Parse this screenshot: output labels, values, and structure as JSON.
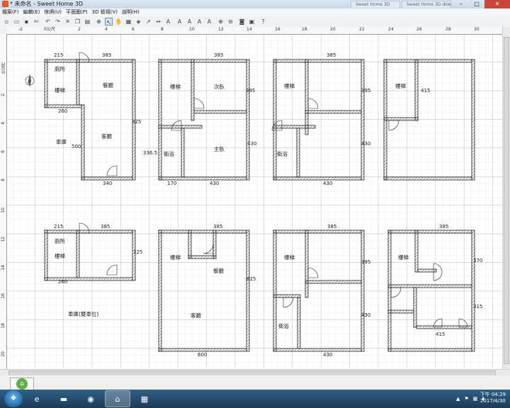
{
  "window": {
    "title": "* 未命名 - Sweet Home 3D",
    "ghost_tabs": [
      "Sweet Home 3D",
      "Sweet Home 3D download"
    ],
    "controls": [
      "–",
      "□",
      "✕"
    ]
  },
  "menu": [
    "檔案(F)",
    "編輯(E)",
    "傢俱(U)",
    "平面圖(P)",
    "3D 檢視(V)",
    "說明(H)"
  ],
  "toolbar_icons": [
    "new-icon",
    "open-icon",
    "save-icon",
    "cut-icon",
    "undo-icon",
    "redo-icon",
    "delete-icon",
    "copy-icon",
    "paste-icon",
    "add-furniture-icon",
    "select-icon",
    "pan-icon",
    "create-walls-icon",
    "create-rooms-icon",
    "create-dimensions-icon",
    "add-text-icon",
    "zoom-in-icon",
    "zoom-out-icon",
    "camera-icon",
    "photo-icon",
    "video-icon",
    "help-icon"
  ],
  "ruler": {
    "top": [
      "-2",
      "0公尺",
      "2",
      "4",
      "6",
      "8",
      "10",
      "12",
      "14",
      "16",
      "18",
      "20",
      "22",
      "24",
      "26",
      "28",
      "30"
    ],
    "left": [
      "0公尺",
      "2",
      "4",
      "6",
      "8",
      "10",
      "12",
      "14",
      "16",
      "18",
      "20"
    ]
  },
  "plans": [
    {
      "labels": [
        "廁所",
        "樓梯",
        "餐廳",
        "客廳",
        "車庫"
      ],
      "dims": [
        "215",
        "385",
        "260",
        "825",
        "500",
        "340"
      ]
    },
    {
      "labels": [
        "樓梯",
        "次臥",
        "衛浴",
        "主臥"
      ],
      "dims": [
        "385",
        "395",
        "336.5",
        "430",
        "170",
        "430"
      ]
    },
    {
      "labels": [
        "樓梯",
        "衛浴"
      ],
      "dims": [
        "385",
        "395",
        "430",
        "430"
      ]
    },
    {
      "labels": [
        "樓梯"
      ],
      "dims": [
        "415"
      ]
    },
    {
      "labels": [
        "廁所",
        "樓梯",
        "車庫(雙車位)"
      ],
      "dims": [
        "215",
        "385",
        "325",
        "260"
      ]
    },
    {
      "labels": [
        "樓梯",
        "餐廳",
        "客廳"
      ],
      "dims": [
        "385",
        "825",
        "600"
      ]
    },
    {
      "labels": [
        "樓梯",
        "衛浴"
      ],
      "dims": [
        "385",
        "395",
        "430",
        "430"
      ]
    },
    {
      "labels": [
        "樓梯"
      ],
      "dims": [
        "385",
        "370",
        "315",
        "415"
      ]
    }
  ],
  "taskbar": {
    "start_icon": "windows-start-icon",
    "apps": [
      "ie-icon",
      "explorer-icon",
      "firefox-icon",
      "sweethome3d-icon",
      "app-icon"
    ],
    "tray_icons": [
      "arrow-up-icon",
      "flag-icon",
      "network-icon",
      "volume-icon"
    ],
    "time": "下午 04:29",
    "date": "2017/4/30"
  }
}
